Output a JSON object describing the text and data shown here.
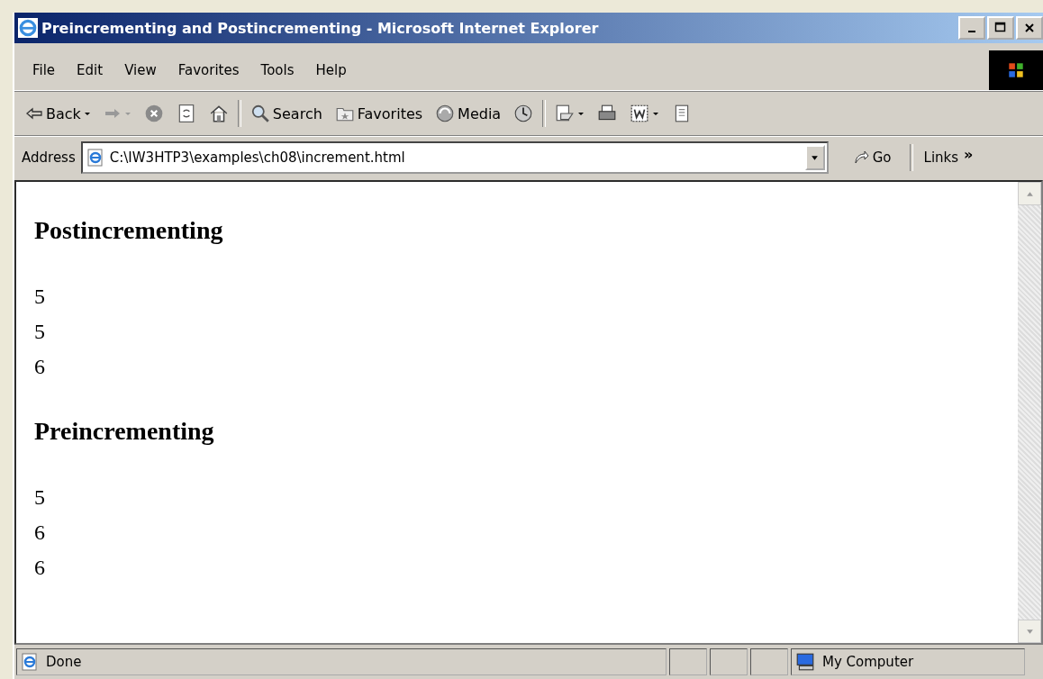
{
  "window": {
    "title": "Preincrementing and Postincrementing - Microsoft Internet Explorer"
  },
  "menu": [
    "File",
    "Edit",
    "View",
    "Favorites",
    "Tools",
    "Help"
  ],
  "toolbar": [
    {
      "kind": "back",
      "label": "Back"
    },
    {
      "kind": "forward"
    },
    {
      "kind": "stop"
    },
    {
      "kind": "refresh"
    },
    {
      "kind": "home"
    },
    {
      "kind": "sep"
    },
    {
      "kind": "search",
      "label": "Search"
    },
    {
      "kind": "favorites",
      "label": "Favorites"
    },
    {
      "kind": "media",
      "label": "Media"
    },
    {
      "kind": "history"
    },
    {
      "kind": "sep"
    },
    {
      "kind": "mail"
    },
    {
      "kind": "print"
    },
    {
      "kind": "edit"
    },
    {
      "kind": "discuss"
    }
  ],
  "address": {
    "label": "Address",
    "value": "C:\\IW3HTP3\\examples\\ch08\\increment.html",
    "go": "Go",
    "links": "Links",
    "more": "»"
  },
  "content": [
    {
      "heading": "Postincrementing",
      "lines": [
        "5",
        "5",
        "6"
      ]
    },
    {
      "heading": "Preincrementing",
      "lines": [
        "5",
        "6",
        "6"
      ]
    }
  ],
  "status_bar": {
    "text": "Done",
    "zone": "My Computer"
  }
}
